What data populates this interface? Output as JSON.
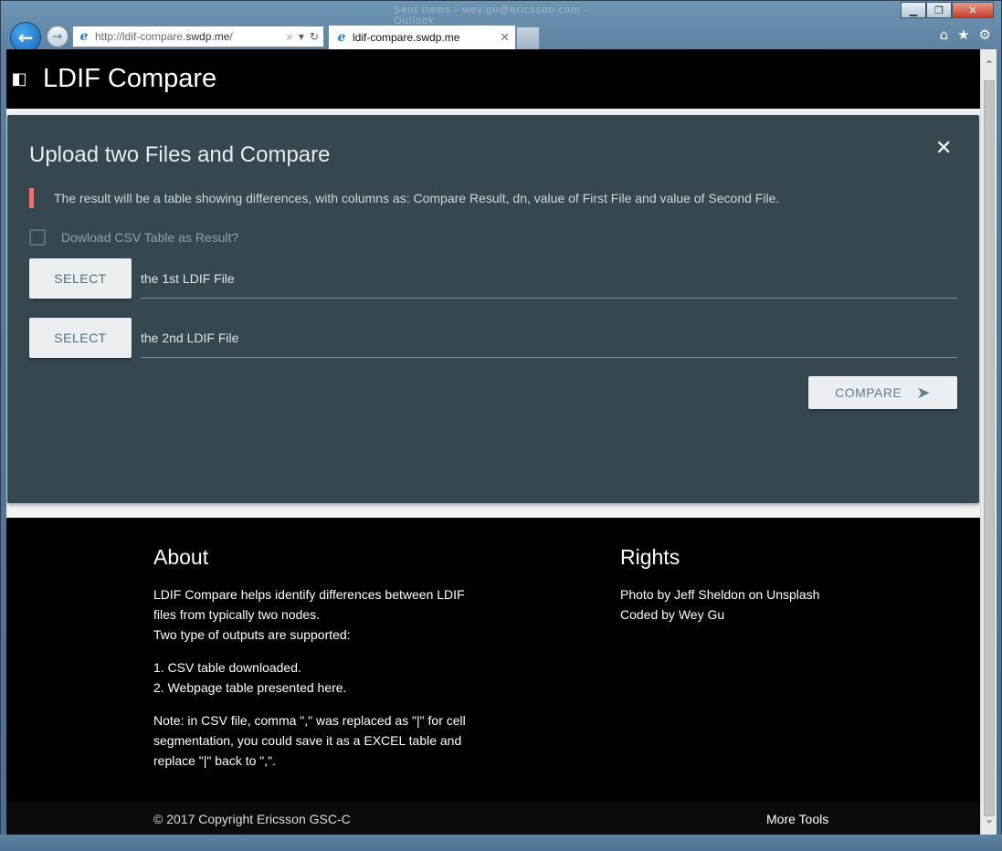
{
  "window": {
    "title_blurred": "Sent Items - wey.gu@ericsson.com - Outlook",
    "minimize_glyph": "▁",
    "restore_glyph": "❐",
    "close_glyph": "✕"
  },
  "browser": {
    "back_glyph": "←",
    "forward_glyph": "→",
    "address_prefix": "http://ldif-compare.",
    "address_domain": "swdp.me",
    "address_suffix": "/",
    "address_search_glyph": "⌕",
    "address_dropdown_glyph": "▾",
    "address_refresh_glyph": "↻",
    "tab_title": "ldif-compare.swdp.me",
    "tab_close_glyph": "✕",
    "home_glyph": "⌂",
    "favorites_glyph": "★",
    "settings_glyph": "⚙"
  },
  "app": {
    "logo_glyph": "◧",
    "title": "LDIF Compare"
  },
  "card": {
    "title": "Upload two Files and Compare",
    "close_glyph": "✕",
    "note": "The result will be a table showing differences, with columns as: Compare Result, dn, value of First File and value of Second File.",
    "checkbox_label": "Dowload CSV Table as Result?",
    "checkbox_checked": false,
    "file1": {
      "button": "SELECT",
      "placeholder": "the 1st LDIF File"
    },
    "file2": {
      "button": "SELECT",
      "placeholder": "the 2nd LDIF File"
    },
    "compare_button": "COMPARE",
    "compare_icon": "➤"
  },
  "footer": {
    "about": {
      "heading": "About",
      "line1": "LDIF Compare helps identify differences between LDIF",
      "line2": "files from typically two nodes.",
      "line3": "Two type of outputs are supported:",
      "list": [
        "1. CSV table downloaded.",
        "2. Webpage table presented here."
      ],
      "note1": "Note: in CSV file, comma \",\" was replaced as \"|\" for cell",
      "note2": "segmentation, you could save it as a EXCEL table and",
      "note3": "replace \"|\" back to \",\"."
    },
    "rights": {
      "heading": "Rights",
      "line1": "Photo by Jeff Sheldon on Unsplash",
      "line2": "Coded by Wey Gu"
    },
    "copyright": "© 2017 Copyright Ericsson GSC-C",
    "more_tools": "More Tools"
  },
  "scrollbar": {
    "up_glyph": "⌃",
    "down_glyph": "⌄"
  },
  "colors": {
    "card_bg": "#37474f",
    "note_accent": "#e57373",
    "header_bg": "#000000",
    "button_bg": "#eceff1"
  }
}
